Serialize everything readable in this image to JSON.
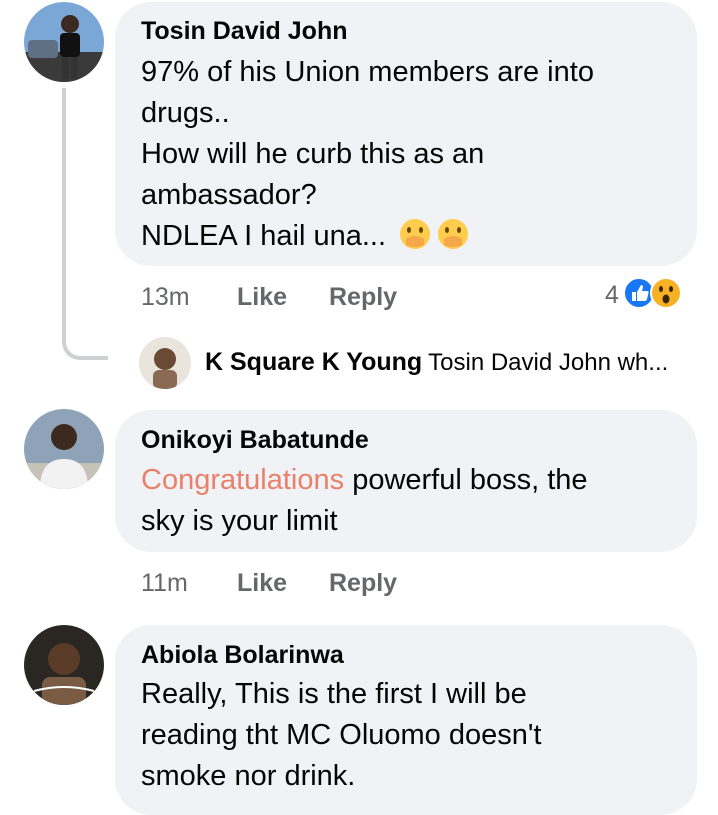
{
  "comments": [
    {
      "author": "Tosin David John",
      "lines": [
        "97% of his Union members are into",
        "drugs..",
        "How will he curb this as an",
        "ambassador?",
        "NDLEA I hail una..."
      ],
      "emoji_icons": [
        "hand-over-mouth-emoji-icon",
        "hand-over-mouth-emoji-icon"
      ],
      "time": "13m",
      "like_label": "Like",
      "reply_label": "Reply",
      "reaction_count": "4",
      "reaction_icons": [
        "like-reaction-icon",
        "wow-reaction-icon"
      ]
    },
    {
      "author": "Onikoyi Babatunde",
      "highlight": "Congratulations",
      "lines": [
        " powerful boss, the",
        "sky is your limit"
      ],
      "time": "11m",
      "like_label": "Like",
      "reply_label": "Reply"
    },
    {
      "author": "Abiola Bolarinwa",
      "lines": [
        "Really, This is the first I will be",
        "reading tht MC Oluomo doesn't",
        "smoke nor drink."
      ]
    }
  ],
  "reply_preview": {
    "author": "K Square K Young",
    "snippet": "Tosin David John wh..."
  },
  "colors": {
    "bubble": "#f0f2f5",
    "meta_text": "#65676b",
    "highlight": "#e9806a",
    "like_blue": "#1877f2",
    "wow_yellow": "#f7b125"
  }
}
